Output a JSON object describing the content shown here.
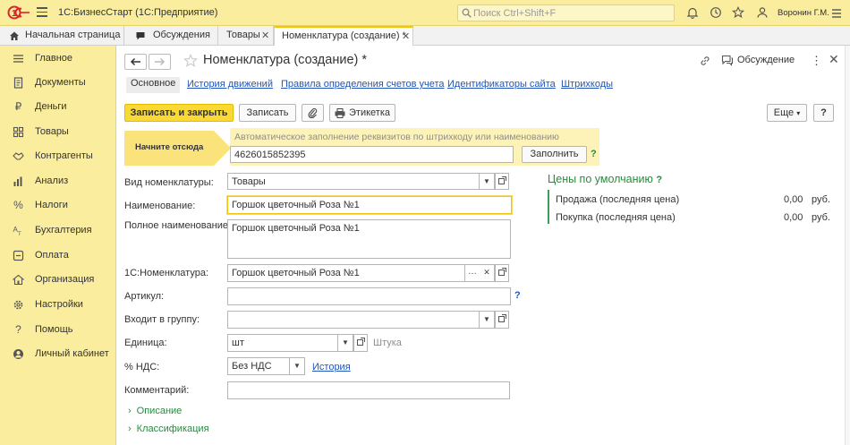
{
  "app": {
    "title": "1С:БизнесСтарт  (1С:Предприятие)",
    "search_placeholder": "Поиск Ctrl+Shift+F",
    "user": "Воронин Г.М."
  },
  "tabs": [
    {
      "label": "Начальная страница"
    },
    {
      "label": "Обсуждения"
    },
    {
      "label": "Товары"
    },
    {
      "label": "Номенклатура (создание) *"
    }
  ],
  "sidebar": {
    "items": [
      {
        "label": "Главное",
        "icon": "menu-lines-icon"
      },
      {
        "label": "Документы",
        "icon": "document-icon"
      },
      {
        "label": "Деньги",
        "icon": "ruble-icon"
      },
      {
        "label": "Товары",
        "icon": "grid-icon"
      },
      {
        "label": "Контрагенты",
        "icon": "handshake-icon"
      },
      {
        "label": "Анализ",
        "icon": "chart-icon"
      },
      {
        "label": "Налоги",
        "icon": "percent-icon"
      },
      {
        "label": "Бухгалтерия",
        "icon": "accounting-icon"
      },
      {
        "label": "Оплата",
        "icon": "payment-icon"
      },
      {
        "label": "Организация",
        "icon": "building-icon"
      },
      {
        "label": "Настройки",
        "icon": "gear-icon"
      },
      {
        "label": "Помощь",
        "icon": "question-icon"
      },
      {
        "label": "Личный кабинет",
        "icon": "account-icon"
      }
    ]
  },
  "form": {
    "title": "Номенклатура (создание) *",
    "discussion": "Обсуждение",
    "subtabs": [
      "Основное",
      "История движений",
      "Правила определения счетов учета",
      "Идентификаторы сайта",
      "Штрихкоды"
    ],
    "buttons": {
      "save_close": "Записать и закрыть",
      "save": "Записать",
      "label": "Этикетка",
      "more": "Еще",
      "help": "?"
    },
    "barcode": {
      "start": "Начните отсюда",
      "hint": "Автоматическое заполнение реквизитов по штрихкоду или наименованию",
      "value": "4626015852395",
      "fill": "Заполнить"
    },
    "fields": {
      "kind_label": "Вид номенклатуры:",
      "kind_value": "Товары",
      "name_label": "Наименование:",
      "name_value": "Горшок цветочный Роза №1",
      "fullname_label": "Полное наименование:",
      "fullname_value": "Горшок цветочный Роза №1",
      "nom1c_label": "1С:Номенклатура:",
      "nom1c_value": "Горшок цветочный Роза №1",
      "article_label": "Артикул:",
      "article_value": "",
      "group_label": "Входит в группу:",
      "group_value": "",
      "unit_label": "Единица:",
      "unit_value": "шт",
      "unit_hint": "Штука",
      "vat_label": "% НДС:",
      "vat_value": "Без НДС",
      "vat_history": "История",
      "comment_label": "Комментарий:",
      "comment_value": ""
    },
    "sections": [
      "Описание",
      "Классификация"
    ],
    "prices": {
      "title": "Цены по умолчанию",
      "rows": [
        {
          "label": "Продажа (последняя цена)",
          "value": "0,00",
          "currency": "руб."
        },
        {
          "label": "Покупка (последняя цена)",
          "value": "0,00",
          "currency": "руб."
        }
      ]
    }
  },
  "colors": {
    "accent_yellow": "#fbed9e",
    "primary_button": "#fad835",
    "link": "#2155b8",
    "green": "#2a8a3f"
  }
}
